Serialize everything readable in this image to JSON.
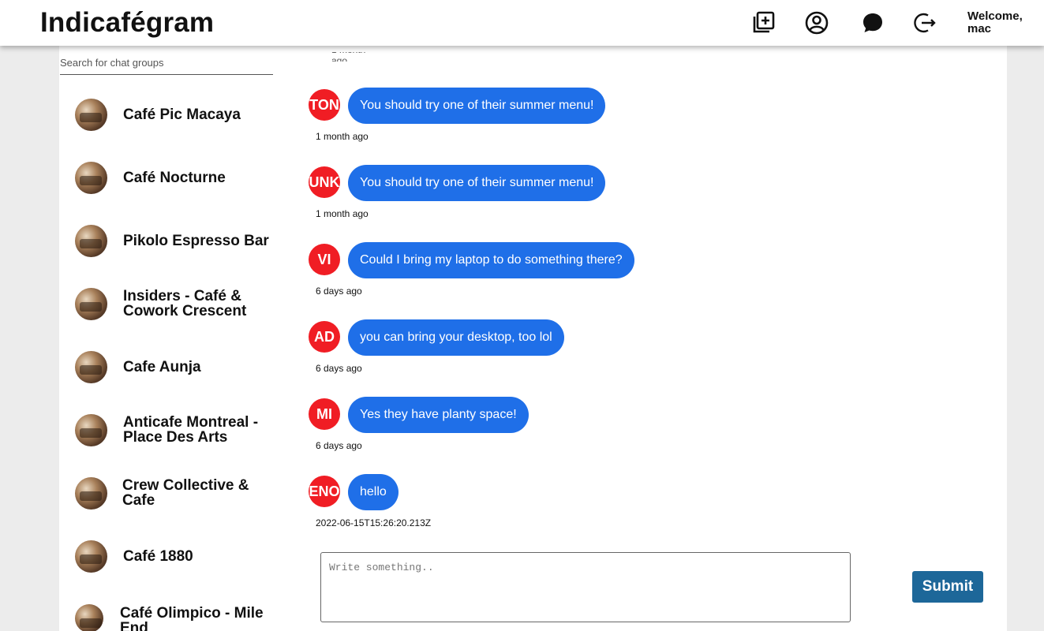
{
  "header": {
    "brand": "Indicafégram",
    "icons": [
      "add-post-icon",
      "profile-icon",
      "chat-icon",
      "logout-icon"
    ],
    "welcome_line1": "Welcome,",
    "welcome_line2": "mac"
  },
  "sidebar": {
    "search_placeholder": "Search for chat groups",
    "groups": [
      {
        "name": "Café Pic Macaya"
      },
      {
        "name": "Café Nocturne"
      },
      {
        "name": "Pikolo Espresso Bar"
      },
      {
        "name": "Insiders - Café & Cowork Crescent"
      },
      {
        "name": "Cafe Aunja"
      },
      {
        "name": "Anticafe Montreal - Place Des Arts"
      },
      {
        "name": "Crew Collective & Cafe"
      },
      {
        "name": "Café 1880"
      },
      {
        "name": "Café Olimpico - Mile End"
      }
    ]
  },
  "chat": {
    "messages": [
      {
        "initials": "TON",
        "text": "You should try one of their summer menu!",
        "time": "1 month ago"
      },
      {
        "initials": "UNK",
        "text": "You should try one of their summer menu!",
        "time": "1 month ago"
      },
      {
        "initials": "VI",
        "text": "Could I bring my laptop to do something there?",
        "time": "6 days ago"
      },
      {
        "initials": "AD",
        "text": "you can bring your desktop, too lol",
        "time": "6 days ago"
      },
      {
        "initials": "MI",
        "text": "Yes they have planty space!",
        "time": "6 days ago"
      },
      {
        "initials": "ENO",
        "text": "hello",
        "time": "2022-06-15T15:26:20.213Z"
      }
    ],
    "compose_placeholder": "Write something..",
    "submit_label": "Submit"
  },
  "colors": {
    "accent_blue": "#1f6fe8",
    "avatar_red": "#f01d24",
    "submit_blue": "#1d6799"
  }
}
